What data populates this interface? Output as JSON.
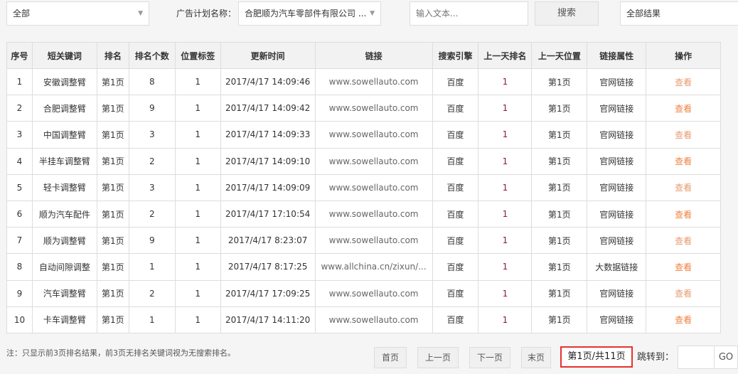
{
  "filters": {
    "scope": "全部",
    "plan_label": "广告计划名称：",
    "plan_value": "合肥顺为汽车零部件有限公司 ...",
    "search_placeholder": "输入文本...",
    "search_button": "搜索",
    "result_filter": "全部结果"
  },
  "table": {
    "headers": [
      "序号",
      "短关键词",
      "排名",
      "排名个数",
      "位置标签",
      "更新时间",
      "链接",
      "搜索引擎",
      "上一天排名",
      "上一天位置",
      "链接属性",
      "操作"
    ],
    "rows": [
      [
        "1",
        "安徽调整臂",
        "第1页",
        "8",
        "1",
        "2017/4/17 14:09:46",
        "www.sowellauto.com",
        "百度",
        "1",
        "第1页",
        "官网链接",
        "查看"
      ],
      [
        "2",
        "合肥调整臂",
        "第1页",
        "9",
        "1",
        "2017/4/17 14:09:42",
        "www.sowellauto.com",
        "百度",
        "1",
        "第1页",
        "官网链接",
        "查看"
      ],
      [
        "3",
        "中国调整臂",
        "第1页",
        "3",
        "1",
        "2017/4/17 14:09:33",
        "www.sowellauto.com",
        "百度",
        "1",
        "第1页",
        "官网链接",
        "查看"
      ],
      [
        "4",
        "半挂车调整臂",
        "第1页",
        "2",
        "1",
        "2017/4/17 14:09:10",
        "www.sowellauto.com",
        "百度",
        "1",
        "第1页",
        "官网链接",
        "查看"
      ],
      [
        "5",
        "轻卡调整臂",
        "第1页",
        "3",
        "1",
        "2017/4/17 14:09:09",
        "www.sowellauto.com",
        "百度",
        "1",
        "第1页",
        "官网链接",
        "查看"
      ],
      [
        "6",
        "顺为汽车配件",
        "第1页",
        "2",
        "1",
        "2017/4/17 17:10:54",
        "www.sowellauto.com",
        "百度",
        "1",
        "第1页",
        "官网链接",
        "查看"
      ],
      [
        "7",
        "顺为调整臂",
        "第1页",
        "9",
        "1",
        "2017/4/17 8:23:07",
        "www.sowellauto.com",
        "百度",
        "1",
        "第1页",
        "官网链接",
        "查看"
      ],
      [
        "8",
        "自动间隙调整",
        "第1页",
        "1",
        "1",
        "2017/4/17 8:17:25",
        "www.allchina.cn/zixun/...",
        "百度",
        "1",
        "第1页",
        "大数据链接",
        "查看"
      ],
      [
        "9",
        "汽车调整臂",
        "第1页",
        "2",
        "1",
        "2017/4/17 17:09:25",
        "www.sowellauto.com",
        "百度",
        "1",
        "第1页",
        "官网链接",
        "查看"
      ],
      [
        "10",
        "卡车调整臂",
        "第1页",
        "1",
        "1",
        "2017/4/17 14:11:20",
        "www.sowellauto.com",
        "百度",
        "1",
        "第1页",
        "官网链接",
        "查看"
      ]
    ]
  },
  "footer": {
    "note": "注：只显示前3页排名结果，前3页无排名关键词视为无搜索排名。",
    "first": "首页",
    "prev": "上一页",
    "next": "下一页",
    "last": "末页",
    "page_info": "第1页/共11页",
    "jump_label": "跳转到：",
    "jump_value": "",
    "go": "GO"
  },
  "colors": {
    "action": "#f08040",
    "highlight_border": "#e83030"
  }
}
